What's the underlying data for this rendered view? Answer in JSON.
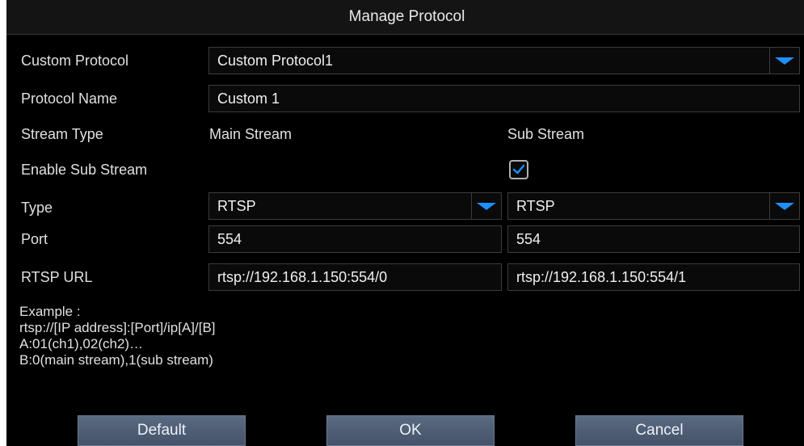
{
  "title": "Manage Protocol",
  "fields": {
    "custom_protocol": {
      "label": "Custom Protocol",
      "value": "Custom Protocol1"
    },
    "protocol_name": {
      "label": "Protocol Name",
      "value": "Custom 1"
    },
    "stream_type": {
      "label": "Stream Type",
      "main": "Main Stream",
      "sub": "Sub Stream"
    },
    "enable_sub_stream": {
      "label": "Enable Sub Stream",
      "checked": true
    },
    "type": {
      "label": "Type",
      "main_value": "RTSP",
      "sub_value": "RTSP"
    },
    "port": {
      "label": "Port",
      "main_value": "554",
      "sub_value": "554"
    },
    "rtsp_url": {
      "label": "RTSP URL",
      "main_value": "rtsp://192.168.1.150:554/0",
      "sub_value": "rtsp://192.168.1.150:554/1"
    }
  },
  "example": {
    "lines": [
      "Example :",
      "rtsp://[IP address]:[Port]/ip[A]/[B]",
      "A:01(ch1),02(ch2)…",
      "B:0(main stream),1(sub stream)"
    ]
  },
  "buttons": {
    "default": "Default",
    "ok": "OK",
    "cancel": "Cancel"
  },
  "colors": {
    "accent": "#1e90ff",
    "background": "#000000",
    "button": "#4f5e76"
  }
}
